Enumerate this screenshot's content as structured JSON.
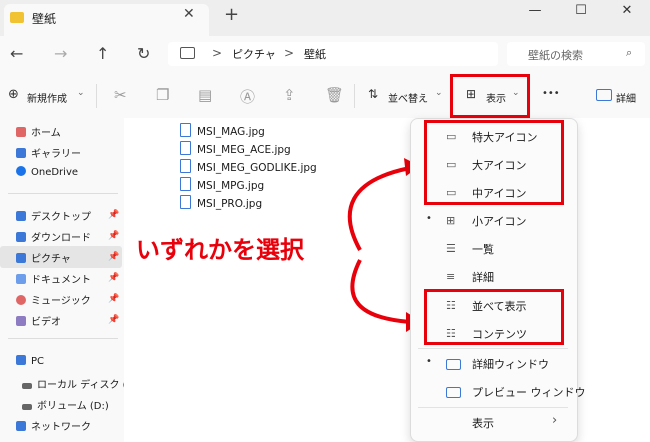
{
  "window": {
    "tab_title": "壁紙",
    "close": "✕",
    "new_tab": "+",
    "min": "—",
    "max": "☐",
    "close_win": "✕"
  },
  "nav": {
    "back": "←",
    "forward": "→",
    "up": "↑",
    "refresh": "↻",
    "sep": ">",
    "path": [
      "ピクチャ",
      "壁紙"
    ],
    "search_placeholder": "壁紙の検索"
  },
  "toolbar": {
    "new_label": "新規作成",
    "sort_label": "並べ替え",
    "view_label": "表示",
    "more": "•••",
    "details_label": "詳細"
  },
  "sidebar": {
    "items": [
      {
        "label": "ホーム",
        "icon": "home-icon",
        "color": "#e06666"
      },
      {
        "label": "ギャラリー",
        "icon": "gallery-icon",
        "color": "#3c78d8"
      },
      {
        "label": "OneDrive",
        "icon": "cloud-icon",
        "color": "#1a73e8"
      },
      {
        "label": "デスクトップ",
        "icon": "desktop-icon",
        "color": "#3c78d8"
      },
      {
        "label": "ダウンロード",
        "icon": "download-icon",
        "color": "#3c78d8"
      },
      {
        "label": "ピクチャ",
        "icon": "pictures-icon",
        "color": "#3c78d8"
      },
      {
        "label": "ドキュメント",
        "icon": "documents-icon",
        "color": "#6d9eeb"
      },
      {
        "label": "ミュージック",
        "icon": "music-icon",
        "color": "#e06666"
      },
      {
        "label": "ビデオ",
        "icon": "video-icon",
        "color": "#8e7cc3"
      },
      {
        "label": "PC",
        "icon": "pc-icon",
        "color": "#3c78d8"
      },
      {
        "label": "ローカル ディスク (C:",
        "icon": "drive-icon",
        "color": "#666666"
      },
      {
        "label": "ボリューム (D:)",
        "icon": "drive-icon",
        "color": "#666666"
      },
      {
        "label": "ネットワーク",
        "icon": "network-icon",
        "color": "#3c78d8"
      }
    ]
  },
  "files": [
    "MSI_MAG.jpg",
    "MSI_MEG_ACE.jpg",
    "MSI_MEG_GODLIKE.jpg",
    "MSI_MPG.jpg",
    "MSI_PRO.jpg"
  ],
  "menu": {
    "items": [
      "特大アイコン",
      "大アイコン",
      "中アイコン",
      "小アイコン",
      "一覧",
      "詳細",
      "並べて表示",
      "コンテンツ",
      "詳細ウィンドウ",
      "プレビュー ウィンドウ",
      "表示"
    ],
    "selected_bullet": "•",
    "submenu_arrow": "›"
  },
  "annotation": {
    "text": "いずれかを選択",
    "color": "#e8000b"
  }
}
